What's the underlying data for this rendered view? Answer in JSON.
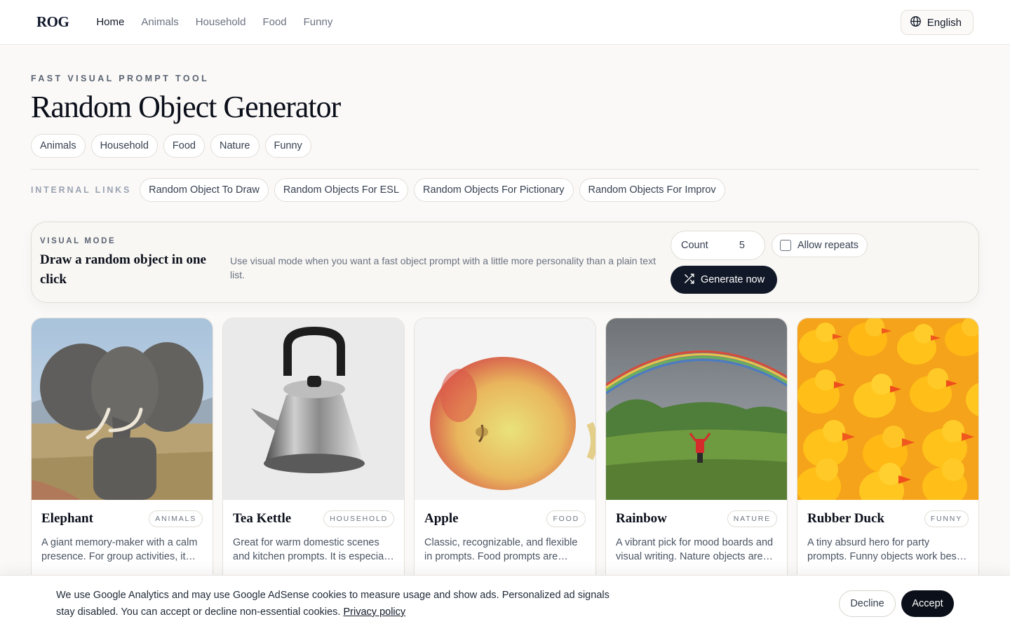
{
  "header": {
    "logo": "ROG",
    "nav": [
      {
        "label": "Home",
        "active": true
      },
      {
        "label": "Animals"
      },
      {
        "label": "Household"
      },
      {
        "label": "Food"
      },
      {
        "label": "Funny"
      }
    ],
    "language": "English"
  },
  "hero": {
    "eyebrow": "FAST VISUAL PROMPT TOOL",
    "title": "Random Object Generator",
    "categories": [
      "Animals",
      "Household",
      "Food",
      "Nature",
      "Funny"
    ]
  },
  "internal_links": {
    "label": "INTERNAL LINKS",
    "links": [
      "Random Object To Draw",
      "Random Objects For ESL",
      "Random Objects For Pictionary",
      "Random Objects For Improv"
    ]
  },
  "visual_mode": {
    "label": "VISUAL MODE",
    "heading": "Draw a random object in one click",
    "description": "Use visual mode when you want a fast object prompt with a little more personality than a plain text list.",
    "count_label": "Count",
    "count_value": "5",
    "allow_repeats_label": "Allow repeats",
    "allow_repeats_checked": false,
    "generate_label": "Generate now"
  },
  "cards": [
    {
      "name": "Elephant",
      "category": "ANIMALS",
      "description": "A giant memory-maker with a calm presence. For group activities, it works well as a warm-up prompt."
    },
    {
      "name": "Tea Kettle",
      "category": "HOUSEHOLD",
      "description": "Great for warm domestic scenes and kitchen prompts. It is especially handy for quick sketches."
    },
    {
      "name": "Apple",
      "category": "FOOD",
      "description": "Classic, recognizable, and flexible in prompts. Food prompts are concrete and easy to describe."
    },
    {
      "name": "Rainbow",
      "category": "NATURE",
      "description": "A vibrant pick for mood boards and visual writing. Nature objects are great for setting a scene."
    },
    {
      "name": "Rubber Duck",
      "category": "FUNNY",
      "description": "A tiny absurd hero for party prompts. Funny objects work best when the group needs energy."
    }
  ],
  "cookie": {
    "text": "We use Google Analytics and may use Google AdSense cookies to measure usage and show ads. Personalized ad signals stay disabled. You can accept or decline non-essential cookies.",
    "policy_link": "Privacy policy",
    "decline_label": "Decline",
    "accept_label": "Accept"
  }
}
